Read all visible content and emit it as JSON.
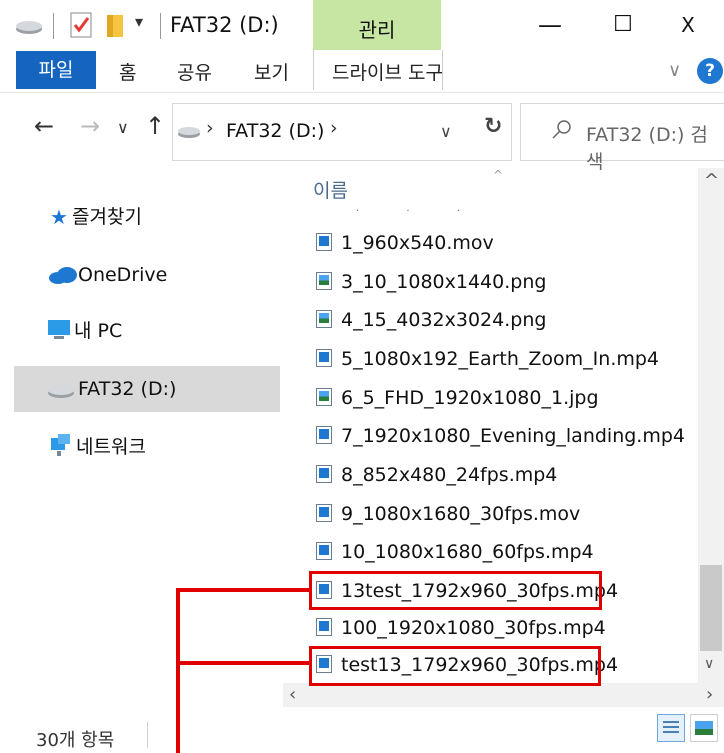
{
  "titlebar": {
    "title": "FAT32 (D:)",
    "manage_tab": "관리",
    "minimize": "—",
    "maximize": "☐",
    "close": "X"
  },
  "ribbon": {
    "tabs": [
      "파일",
      "홈",
      "공유",
      "보기"
    ],
    "drive_tools": "드라이브 도구",
    "expand": "∨",
    "help": "?"
  },
  "address": {
    "breadcrumb": "FAT32 (D:)",
    "separator": "›",
    "search_placeholder": "FAT32 (D:) 검색"
  },
  "navpane": {
    "items": [
      "즐겨찾기",
      "OneDrive",
      "내 PC",
      "FAT32 (D:)",
      "네트워크"
    ]
  },
  "list": {
    "column_name": "이름",
    "files": [
      {
        "name": "1_960x540.mov",
        "type": "video"
      },
      {
        "name": "3_10_1080x1440.png",
        "type": "image"
      },
      {
        "name": "4_15_4032x3024.png",
        "type": "image"
      },
      {
        "name": "5_1080x192_Earth_Zoom_In.mp4",
        "type": "video"
      },
      {
        "name": "6_5_FHD_1920x1080_1.jpg",
        "type": "image"
      },
      {
        "name": "7_1920x1080_Evening_landing.mp4",
        "type": "video"
      },
      {
        "name": "8_852x480_24fps.mp4",
        "type": "video"
      },
      {
        "name": "9_1080x1680_30fps.mov",
        "type": "video"
      },
      {
        "name": "10_1080x1680_60fps.mp4",
        "type": "video"
      },
      {
        "name": "13test_1792x960_30fps.mp4",
        "type": "video"
      },
      {
        "name": "100_1920x1080_30fps.mp4",
        "type": "video"
      },
      {
        "name": "test13_1792x960_30fps.mp4",
        "type": "video"
      }
    ]
  },
  "status": {
    "item_count": "30개 항목"
  },
  "colors": {
    "file_tab": "#1565c0",
    "manage_tab": "#c7e6a4",
    "annotation": "#e00000",
    "selected_nav": "#d9d9d9"
  }
}
